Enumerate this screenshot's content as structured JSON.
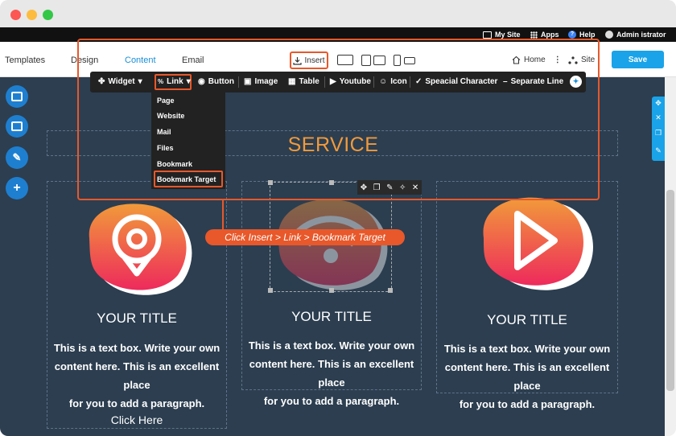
{
  "topbar": {
    "my_site": "My Site",
    "apps": "Apps",
    "help": "Help",
    "user": "Admin istrator"
  },
  "header": {
    "nav": [
      "Templates",
      "Design",
      "Content",
      "Email"
    ],
    "active_nav": "Content",
    "insert": "Insert",
    "home": "Home",
    "site": "Site",
    "save": "Save"
  },
  "insert_bar": {
    "items": [
      "Widget",
      "Link",
      "Button",
      "Image",
      "Table",
      "Youtube",
      "Icon",
      "Speacial Character",
      "Separate Line"
    ]
  },
  "link_menu": {
    "items": [
      "Page",
      "Website",
      "Mail",
      "Files",
      "Bookmark",
      "Bookmark Target"
    ],
    "highlighted": "Bookmark Target"
  },
  "annotation": {
    "label": "Click Insert > Link > Bookmark Target"
  },
  "content": {
    "section_title": "SERVICE",
    "cards": [
      {
        "title": "YOUR TITLE",
        "text": [
          "This is a text box. Write your own",
          "content here. This is an excellent place",
          "for you to add a paragraph."
        ],
        "link": "Click Here",
        "icon": "location-pin-icon"
      },
      {
        "title": "YOUR TITLE",
        "text": [
          "This is a text box. Write your own",
          "content here. This is an excellent place",
          "for you to add a paragraph."
        ],
        "icon": "wifi-icon"
      },
      {
        "title": "YOUR TITLE",
        "text": [
          "This is a text box. Write your own",
          "content here. This is an excellent place",
          "for you to add a paragraph."
        ],
        "icon": "play-icon"
      }
    ]
  },
  "colors": {
    "accent": "#e8582a",
    "brand_blue": "#1aa3e8",
    "canvas_bg": "#2c3e50",
    "service_orange": "#f29a3b"
  }
}
